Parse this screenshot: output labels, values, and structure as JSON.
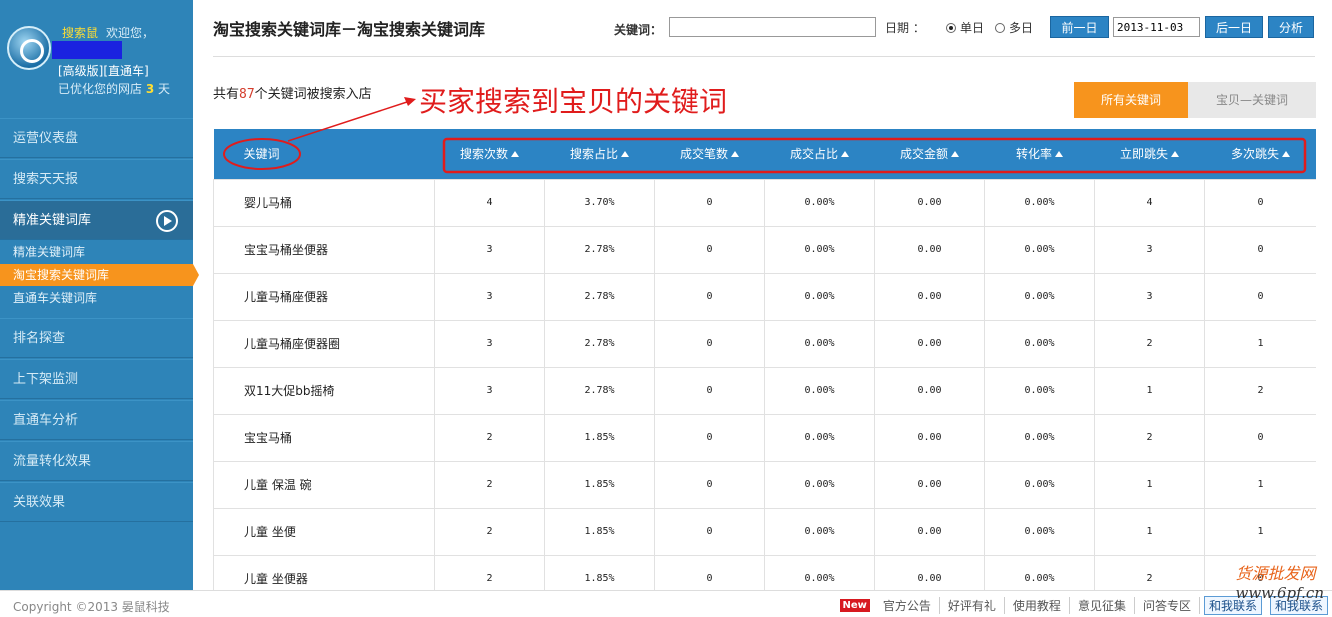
{
  "profile": {
    "name": "搜索鼠",
    "welcome": "欢迎您，",
    "version": "[高级版][直通车]",
    "optimized_prefix": "已优化您的网店",
    "optimized_count": "3",
    "optimized_suffix": "天"
  },
  "sidebar": {
    "items": [
      {
        "label": "运营仪表盘"
      },
      {
        "label": "搜索天天报"
      },
      {
        "label": "精准关键词库"
      },
      {
        "label": "排名探查"
      },
      {
        "label": "上下架监测"
      },
      {
        "label": "直通车分析"
      },
      {
        "label": "流量转化效果"
      },
      {
        "label": "关联效果"
      }
    ],
    "subitems": [
      {
        "label": "精准关键词库"
      },
      {
        "label": "淘宝搜索关键词库"
      },
      {
        "label": "直通车关键词库"
      }
    ]
  },
  "header": {
    "title": "淘宝搜索关键词库－淘宝搜索关键词库",
    "keyword_label": "关键词：",
    "keyword_value": "",
    "date_label": "日期 ：",
    "radio_single": "单日",
    "radio_multi": "多日",
    "prev_day": "前一日",
    "date_value": "2013-11-03",
    "next_day": "后一日",
    "analyze": "分析"
  },
  "summary": {
    "prefix": "共有",
    "count": "87",
    "suffix": "个关键词被搜索入店"
  },
  "annotation": "买家搜索到宝贝的关键词",
  "tabs": {
    "all": "所有关键词",
    "item": "宝贝—关键词"
  },
  "table": {
    "headers": [
      "关键词",
      "搜索次数",
      "搜索占比",
      "成交笔数",
      "成交占比",
      "成交金额",
      "转化率",
      "立即跳失",
      "多次跳失"
    ],
    "rows": [
      [
        "婴儿马桶",
        "4",
        "3.70%",
        "0",
        "0.00%",
        "0.00",
        "0.00%",
        "4",
        "0"
      ],
      [
        "宝宝马桶坐便器",
        "3",
        "2.78%",
        "0",
        "0.00%",
        "0.00",
        "0.00%",
        "3",
        "0"
      ],
      [
        "儿童马桶座便器",
        "3",
        "2.78%",
        "0",
        "0.00%",
        "0.00",
        "0.00%",
        "3",
        "0"
      ],
      [
        "儿童马桶座便器圈",
        "3",
        "2.78%",
        "0",
        "0.00%",
        "0.00",
        "0.00%",
        "2",
        "1"
      ],
      [
        "双11大促bb摇椅",
        "3",
        "2.78%",
        "0",
        "0.00%",
        "0.00",
        "0.00%",
        "1",
        "2"
      ],
      [
        "宝宝马桶",
        "2",
        "1.85%",
        "0",
        "0.00%",
        "0.00",
        "0.00%",
        "2",
        "0"
      ],
      [
        "儿童 保温 碗",
        "2",
        "1.85%",
        "0",
        "0.00%",
        "0.00",
        "0.00%",
        "1",
        "1"
      ],
      [
        "儿童 坐便",
        "2",
        "1.85%",
        "0",
        "0.00%",
        "0.00",
        "0.00%",
        "1",
        "1"
      ],
      [
        "儿童 坐便器",
        "2",
        "1.85%",
        "0",
        "0.00%",
        "0.00",
        "0.00%",
        "2",
        "0"
      ]
    ]
  },
  "footer": {
    "copyright": "Copyright ©2013 晏鼠科技",
    "new_badge": "New",
    "links": [
      "官方公告",
      "好评有礼",
      "使用教程",
      "意见征集",
      "问答专区"
    ],
    "contact1": "和我联系",
    "contact2": "和我联系",
    "watermark1": "货源批发网",
    "watermark2": "www.6pf.cn"
  },
  "colors": {
    "sidebar": "#2e84b8",
    "accent_orange": "#f7941d",
    "table_header": "#2c84c4",
    "annotation_red": "#e01c1c"
  }
}
